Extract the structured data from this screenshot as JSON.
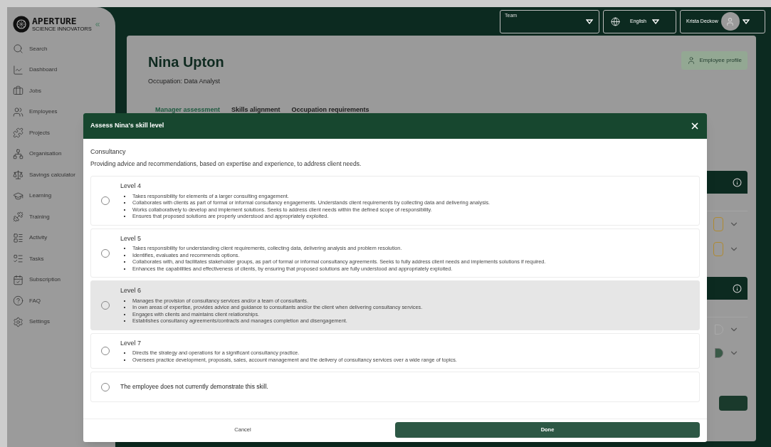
{
  "sidebar": {
    "logo": {
      "name": "APERTURE",
      "tagline": "SCIENCE INNOVATORS"
    },
    "collapse": "«",
    "items": [
      {
        "label": "Search"
      },
      {
        "label": "Dashboard"
      },
      {
        "label": "Jobs"
      },
      {
        "label": "Employees"
      },
      {
        "label": "Projects"
      },
      {
        "label": "Organisation"
      },
      {
        "label": "Savings calculator"
      },
      {
        "label": "Learning"
      },
      {
        "label": "Training"
      },
      {
        "label": "Activity"
      },
      {
        "label": "Tasks"
      },
      {
        "label": "Subscription"
      },
      {
        "label": "FAQ"
      },
      {
        "label": "Settings"
      }
    ]
  },
  "header": {
    "team_select": {
      "label": "Team"
    },
    "language": "English",
    "user": "Krista Deckow"
  },
  "employee": {
    "name": "Nina Upton",
    "occupation": "Occupation: Data Analyst",
    "profile_button": "Employee profile"
  },
  "tabs": [
    {
      "label": "Manager assessment",
      "selected": true
    },
    {
      "label": "Skills alignment",
      "selected": false
    },
    {
      "label": "Occupation requirements",
      "selected": false
    }
  ],
  "modal": {
    "title": "Assess Nina's skill level",
    "skill": "Consultancy",
    "description": "Providing advice and recommendations, based on expertise and experience, to address client needs.",
    "options": [
      {
        "kind": "level",
        "title": "Level 4",
        "selected": false,
        "highlighted": false,
        "bullets": [
          "Takes responsibility for elements of a larger consulting engagement.",
          "Collaborates with clients as part of formal or informal consultancy engagements. Understands client requirements by collecting data and delivering analysis.",
          "Works collaboratively to develop and implement solutions. Seeks to address client needs within the defined scope of responsibility.",
          "Ensures that proposed solutions are properly understood and appropriately exploited."
        ]
      },
      {
        "kind": "level",
        "title": "Level 5",
        "selected": false,
        "highlighted": false,
        "bullets": [
          "Takes responsibility for understanding client requirements, collecting data, delivering analysis and problem resolution.",
          "Identifies, evaluates and recommends options.",
          "Collaborates with, and facilitates stakeholder groups, as part of formal or informal consultancy agreements. Seeks to fully address client needs and implements solutions if required.",
          "Enhances the capabilities and effectiveness of clients, by ensuring that proposed solutions are fully understood and appropriately exploited."
        ]
      },
      {
        "kind": "level",
        "title": "Level 6",
        "selected": false,
        "highlighted": true,
        "bullets": [
          "Manages the provision of consultancy services and/or a team of consultants.",
          "In own areas of expertise, provides advice and guidance to consultants and/or the client when delivering consultancy services.",
          "Engages with clients and maintains client relationships.",
          "Establishes consultancy agreements/contracts and manages completion and disengagement."
        ]
      },
      {
        "kind": "level",
        "title": "Level 7",
        "selected": false,
        "highlighted": false,
        "bullets": [
          "Directs the strategy and operations for a significant consultancy practice.",
          "Oversees practice development, proposals, sales, account management and the delivery of consultancy services over a wide range of topics."
        ]
      },
      {
        "kind": "none",
        "title": "The employee does not currently demonstrate this skill.",
        "selected": false,
        "highlighted": false
      }
    ],
    "cancel": "Cancel",
    "done": "Done"
  }
}
